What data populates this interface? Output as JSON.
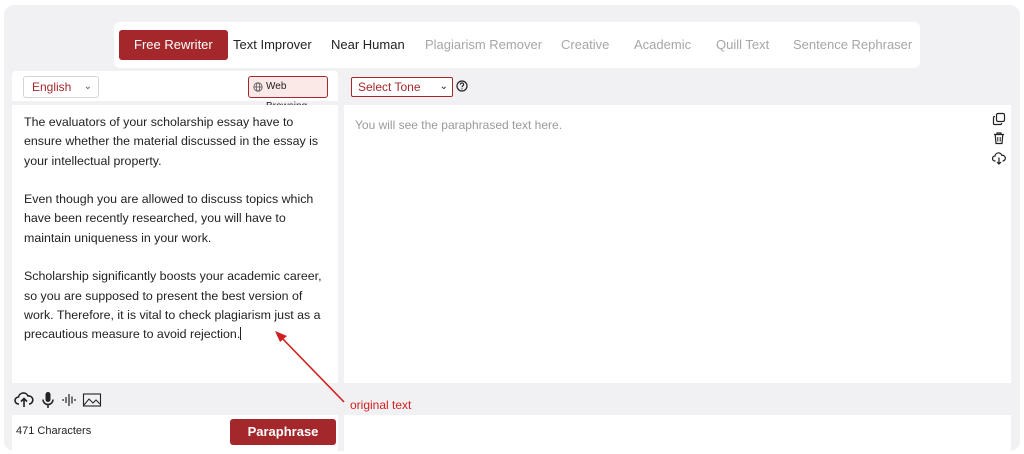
{
  "tabs": [
    {
      "label": "Free Rewriter",
      "state": "active"
    },
    {
      "label": "Text Improver",
      "state": "dark"
    },
    {
      "label": "Near Human",
      "state": "dark"
    },
    {
      "label": "Plagiarism Remover",
      "state": "muted"
    },
    {
      "label": "Creative",
      "state": "muted"
    },
    {
      "label": "Academic",
      "state": "muted"
    },
    {
      "label": "Quill Text",
      "state": "muted"
    },
    {
      "label": "Sentence Rephraser",
      "state": "muted"
    }
  ],
  "input_panel": {
    "language": "English",
    "web_browsing_label": "Web Browsing",
    "paragraphs": [
      "The evaluators of your scholarship essay have to ensure whether the material discussed in the essay is your intellectual property.",
      "Even though you are allowed to discuss topics which have been recently researched, you will have to maintain uniqueness in your work.",
      "Scholarship significantly boosts your academic career, so you are supposed to present the best version of work. Therefore, it is vital to check plagiarism just as a precautious measure to avoid rejection."
    ],
    "char_count": "471 Characters",
    "paraphrase_label": "Paraphrase"
  },
  "output_panel": {
    "tone_select": "Select Tone",
    "placeholder": "You will see the paraphrased text here."
  },
  "annotation": {
    "label": "original text",
    "color": "#d11f1f"
  },
  "colors": {
    "accent": "#a4282b",
    "panel_bg": "#f1f1f4",
    "muted_text": "#a6a6a6"
  },
  "icons": [
    "upload-cloud-icon",
    "microphone-icon",
    "audio-wave-icon",
    "image-icon",
    "globe-icon",
    "help-icon",
    "copy-icon",
    "trash-icon",
    "download-cloud-icon",
    "chevron-down-icon"
  ]
}
